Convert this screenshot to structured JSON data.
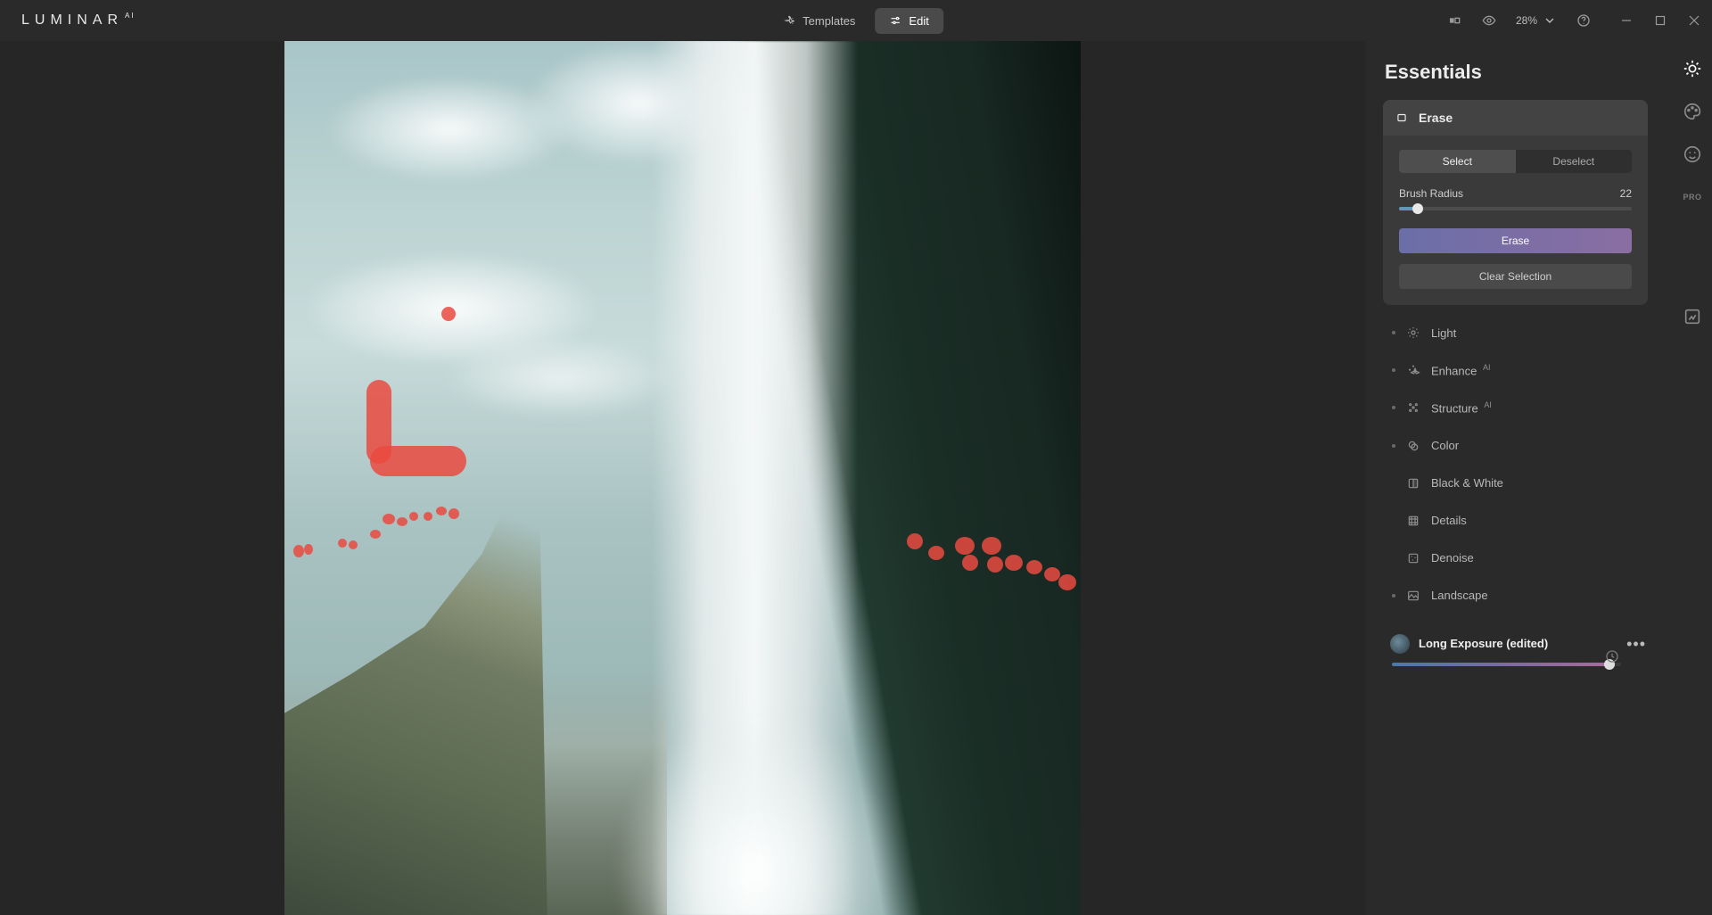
{
  "app": {
    "brand": "LUMINAR",
    "brand_suffix": "AI"
  },
  "topbar": {
    "templates_label": "Templates",
    "edit_label": "Edit",
    "zoom_value": "28%"
  },
  "panel": {
    "title": "Essentials",
    "erase": {
      "header": "Erase",
      "select_label": "Select",
      "deselect_label": "Deselect",
      "brush_label": "Brush Radius",
      "brush_value": "22",
      "erase_btn": "Erase",
      "clear_btn": "Clear Selection"
    },
    "tools": [
      {
        "label": "Light",
        "dot": true,
        "ai": false
      },
      {
        "label": "Enhance",
        "dot": true,
        "ai": true
      },
      {
        "label": "Structure",
        "dot": true,
        "ai": true
      },
      {
        "label": "Color",
        "dot": true,
        "ai": false
      },
      {
        "label": "Black & White",
        "dot": false,
        "ai": false
      },
      {
        "label": "Details",
        "dot": false,
        "ai": false
      },
      {
        "label": "Denoise",
        "dot": false,
        "ai": false
      },
      {
        "label": "Landscape",
        "dot": true,
        "ai": false
      }
    ]
  },
  "strip": {
    "pro_label": "PRO"
  },
  "preset": {
    "name": "Long Exposure (edited)",
    "amount_percent": 95
  },
  "slider_percent": 8
}
